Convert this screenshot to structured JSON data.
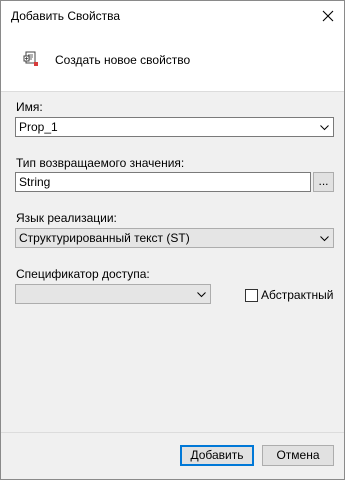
{
  "window": {
    "title": "Добавить Свойства"
  },
  "header": {
    "create_label": "Создать новое свойство"
  },
  "form": {
    "name_label": "Имя:",
    "name_value": "Prop_1",
    "return_type_label": "Тип возвращаемого значения:",
    "return_type_value": "String",
    "browse_label": "...",
    "language_label": "Язык реализации:",
    "language_value": "Структурированный текст (ST)",
    "access_label": "Спецификатор доступа:",
    "access_value": "",
    "abstract_label": "Абстрактный"
  },
  "footer": {
    "add_label": "Добавить",
    "cancel_label": "Отмена"
  },
  "colors": {
    "accent": "#0078d7",
    "panel_bg": "#f0f0f0"
  },
  "icons": {
    "close": "close-icon",
    "create": "new-property-icon",
    "dropdown": "chevron-down-icon"
  }
}
